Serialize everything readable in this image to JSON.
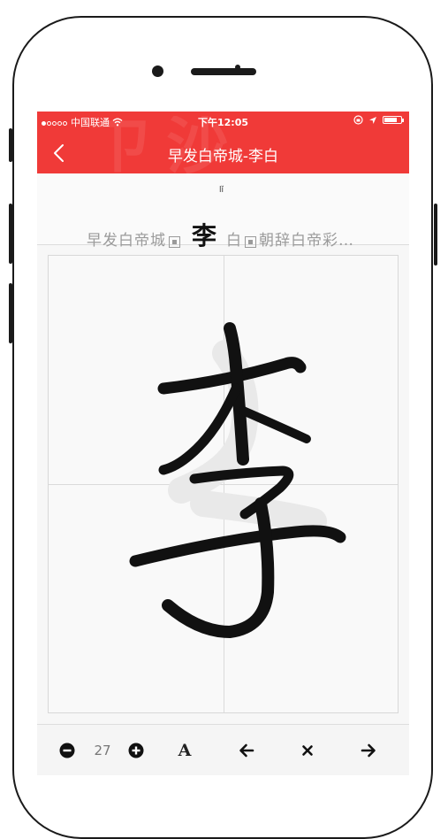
{
  "status_bar": {
    "carrier": "中国联通",
    "time": "下午12:05"
  },
  "nav": {
    "title": "早发白帝城-李白",
    "back_icon": "chevron-left-icon"
  },
  "char_strip": {
    "pinyin": "lǐ",
    "before_text": "早发白帝城",
    "current_char": "李",
    "after_text_1": "白",
    "after_text_2": "朝辞白帝彩…"
  },
  "toolbar": {
    "size_value": "27",
    "font_button_label": "A"
  },
  "colors": {
    "header": "#f03a38",
    "ink": "#111111",
    "grid_line": "#dadada"
  }
}
